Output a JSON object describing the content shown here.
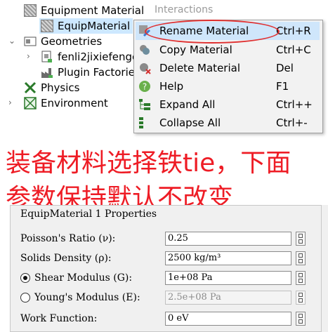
{
  "tree": {
    "ghost_tab": "Interactions",
    "items": [
      {
        "label": "Equipment Material"
      },
      {
        "label": "EquipMaterial"
      },
      {
        "label": "Geometries"
      },
      {
        "label": "fenli2jixiefengc"
      },
      {
        "label": "Plugin Factories"
      },
      {
        "label": "Physics"
      },
      {
        "label": "Environment"
      }
    ]
  },
  "context_menu": {
    "items": [
      {
        "label": "Rename Material",
        "shortcut": "Ctrl+R",
        "icon": "rename-icon"
      },
      {
        "label": "Copy Material",
        "shortcut": "Ctrl+C",
        "icon": "copy-icon"
      },
      {
        "label": "Delete Material",
        "shortcut": "Del",
        "icon": "delete-icon"
      },
      {
        "label": "Help",
        "shortcut": "F1",
        "icon": "help-icon"
      },
      {
        "label": "Expand All",
        "shortcut": "Ctrl++",
        "icon": "expand-icon"
      },
      {
        "label": "Collapse All",
        "shortcut": "Ctrl+-",
        "icon": "collapse-icon"
      }
    ]
  },
  "annotation": {
    "line1": "装备材料选择铁tie，下面",
    "line2": "参数保持默认不改变"
  },
  "properties": {
    "title": "EquipMaterial 1 Properties",
    "rows": [
      {
        "label": "Poisson's Ratio (ν):",
        "value": "0.25"
      },
      {
        "label": "Solids Density (ρ):",
        "value": "2500 kg/m³"
      },
      {
        "label": "Shear Modulus (G):",
        "value": "1e+08 Pa"
      },
      {
        "label": "Young's Modulus (E):",
        "value": "2.5e+08 Pa"
      },
      {
        "label": "Work Function:",
        "value": "0 eV"
      }
    ]
  },
  "colors": {
    "annotation": "#ee1c25",
    "highlight_ring": "#e03030",
    "selection": "#cde8ff"
  }
}
